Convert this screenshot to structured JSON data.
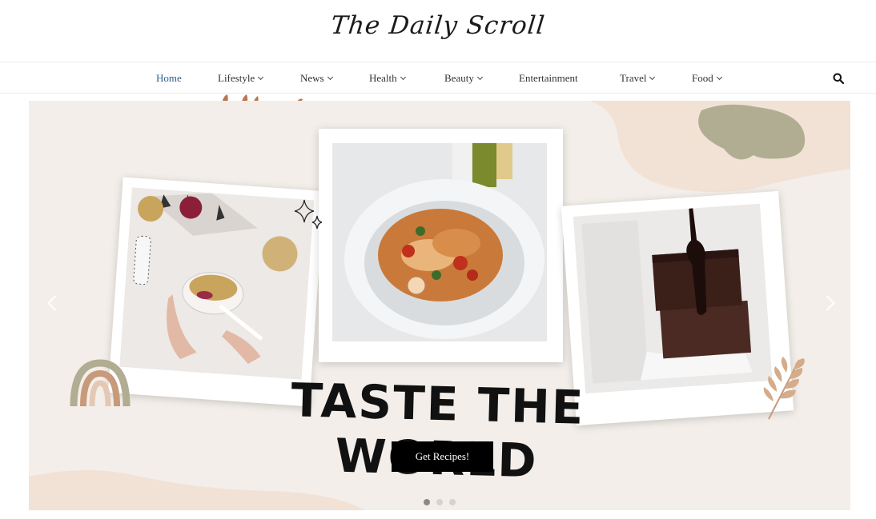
{
  "site": {
    "logo": "The Daily Scroll"
  },
  "nav": {
    "items": [
      {
        "label": "Home",
        "dropdown": false,
        "active": true
      },
      {
        "label": "Lifestyle",
        "dropdown": true
      },
      {
        "label": "News",
        "dropdown": true
      },
      {
        "label": "Health",
        "dropdown": true
      },
      {
        "label": "Beauty",
        "dropdown": true
      },
      {
        "label": "Entertainment",
        "dropdown": false
      },
      {
        "label": "Travel",
        "dropdown": true
      },
      {
        "label": "Food",
        "dropdown": true
      }
    ],
    "search_icon": "search-icon"
  },
  "hero": {
    "headline": "TASTE THE WORLD",
    "cta_label": "Get Recipes!",
    "slides_total": 3,
    "active_slide": 1,
    "photos": [
      "smoothie bowl",
      "seafood pasta",
      "chocolate cake"
    ],
    "colors": {
      "background": "#f3eee9",
      "accent_brown": "#b9774f",
      "accent_olive": "#b0ad93",
      "button": "#000000"
    }
  }
}
